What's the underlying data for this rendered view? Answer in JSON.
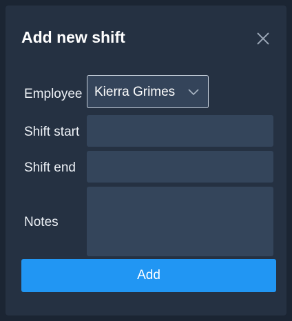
{
  "dialog": {
    "title": "Add new shift",
    "close_icon": "close-icon"
  },
  "form": {
    "employee": {
      "label": "Employee",
      "selected": "Kierra Grimes",
      "icon": "chevron-down-icon"
    },
    "shift_start": {
      "label": "Shift start",
      "value": ""
    },
    "shift_end": {
      "label": "Shift end",
      "value": ""
    },
    "notes": {
      "label": "Notes",
      "value": ""
    }
  },
  "actions": {
    "add_label": "Add"
  },
  "colors": {
    "background": "#1b2533",
    "panel": "#253142",
    "input": "#34455b",
    "accent": "#2196f3"
  }
}
